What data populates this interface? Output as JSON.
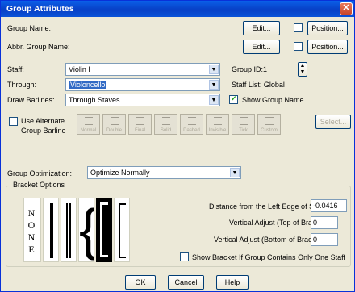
{
  "window": {
    "title": "Group Attributes"
  },
  "labels": {
    "group_name": "Group Name:",
    "abbr_group_name": "Abbr. Group Name:",
    "staff": "Staff:",
    "through": "Through:",
    "draw_barlines": "Draw Barlines:",
    "group_id": "Group ID:",
    "group_id_value": "1",
    "staff_list": "Staff List: Global",
    "show_group_name": "Show Group Name",
    "use_alternate": "Use Alternate",
    "group_barline": "Group Barline",
    "group_optimization": "Group Optimization:",
    "bracket_options": "Bracket Options",
    "distance": "Distance from the Left Edge of Staff:",
    "vertical_top": "Vertical Adjust (Top of Bracket):",
    "vertical_bottom": "Vertical Adjust (Bottom of Bracket):",
    "show_bracket": "Show Bracket If Group Contains Only One Staff"
  },
  "buttons": {
    "edit": "Edit...",
    "position": "Position...",
    "select": "Select...",
    "ok": "OK",
    "cancel": "Cancel",
    "help": "Help"
  },
  "combos": {
    "staff": "Violin I",
    "through": "Violoncello",
    "draw_barlines": "Through Staves",
    "optimization": "Optimize Normally"
  },
  "fields": {
    "distance": "-0.0416",
    "vertical_top": "0",
    "vertical_bottom": "0"
  },
  "barline_styles": [
    "Normal",
    "Double",
    "Final",
    "Solid",
    "Dashed",
    "Invisible",
    "Tick",
    "Custom"
  ],
  "bracket_none_label": "NONE",
  "checks": {
    "show_group_name": true,
    "use_alternate": false,
    "position1": false,
    "position2": false,
    "show_bracket": false
  }
}
